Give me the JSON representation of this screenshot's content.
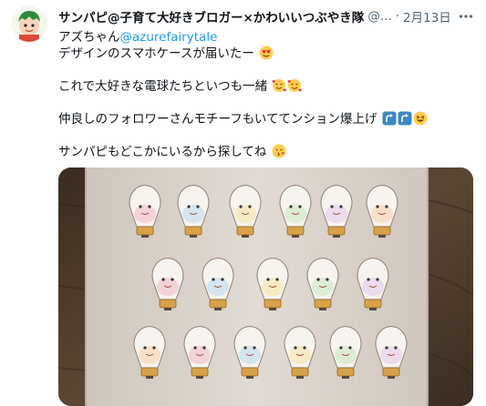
{
  "tweet": {
    "display_name": "サンパピ@子育て大好きブロガー×かわいいつぶやき隊",
    "handle": "@...",
    "dot": "·",
    "date": "2月13日",
    "more_icon": "more-horizontal-icon",
    "lines": {
      "l1_prefix": "アズちゃん",
      "l1_mention": "@azurefairytale",
      "l2": "デザインのスマホケースが届いたー",
      "l3": "これで大好きな電球たちといつも一緒",
      "l4": "仲良しのフォロワーさんモチーフもいててンション爆上げ",
      "l5": "サンパピもどこかにいるから探してね"
    },
    "colors": {
      "text": "#0f1419",
      "secondary": "#536471",
      "link": "#1d9bf0"
    }
  }
}
